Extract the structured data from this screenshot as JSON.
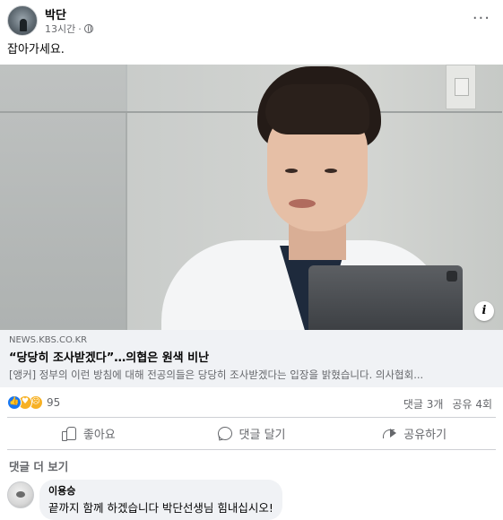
{
  "post": {
    "author": "박단",
    "time": "13시간",
    "text": "잡아가세요."
  },
  "link_preview": {
    "domain": "NEWS.KBS.CO.KR",
    "title": "“당당히 조사받겠다”…의협은 원색 비난",
    "description": "[앵커] 정부의 이런 방침에 대해 전공의들은 당당히 조사받겠다는 입장을 밝혔습니다. 의사협회..."
  },
  "stats": {
    "reaction_count": "95",
    "comments": "댓글 3개",
    "shares": "공유 4회"
  },
  "actions": {
    "like": "좋아요",
    "comment": "댓글 달기",
    "share": "공유하기"
  },
  "comments_section": {
    "more_label": "댓글 더 보기",
    "items": [
      {
        "author": "이용승",
        "text": "끝까지 함께 하겠습니다 박단선생님 힘내십시오!"
      }
    ]
  },
  "icons": {
    "more": "more-horizontal-icon",
    "globe": "globe-icon",
    "info": "info-icon",
    "like_reaction": "like-reaction-icon",
    "care_reaction": "care-reaction-icon",
    "sad_reaction": "sad-reaction-icon",
    "like_action": "thumb-up-icon",
    "comment_action": "comment-icon",
    "share_action": "share-icon"
  },
  "colors": {
    "accent": "#1877f2",
    "secondary_text": "#65676b",
    "preview_bg": "#f0f2f5"
  }
}
